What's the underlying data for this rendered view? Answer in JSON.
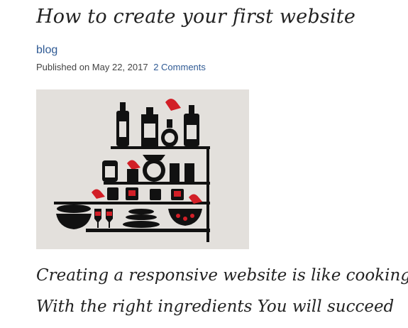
{
  "post": {
    "title": "How to create your first website",
    "category": "blog",
    "published_prefix": "Published on",
    "date": "May 22, 2017",
    "comments_link": "2 Comments",
    "excerpt_lines": [
      "Creating a responsive website is like cooking",
      "With the right ingredients You will succeed"
    ]
  },
  "image": {
    "icon": "kitchen-shelf-illustration",
    "colors": {
      "background": "#e3e0dc",
      "ink": "#111111",
      "accent": "#d21f27"
    }
  }
}
